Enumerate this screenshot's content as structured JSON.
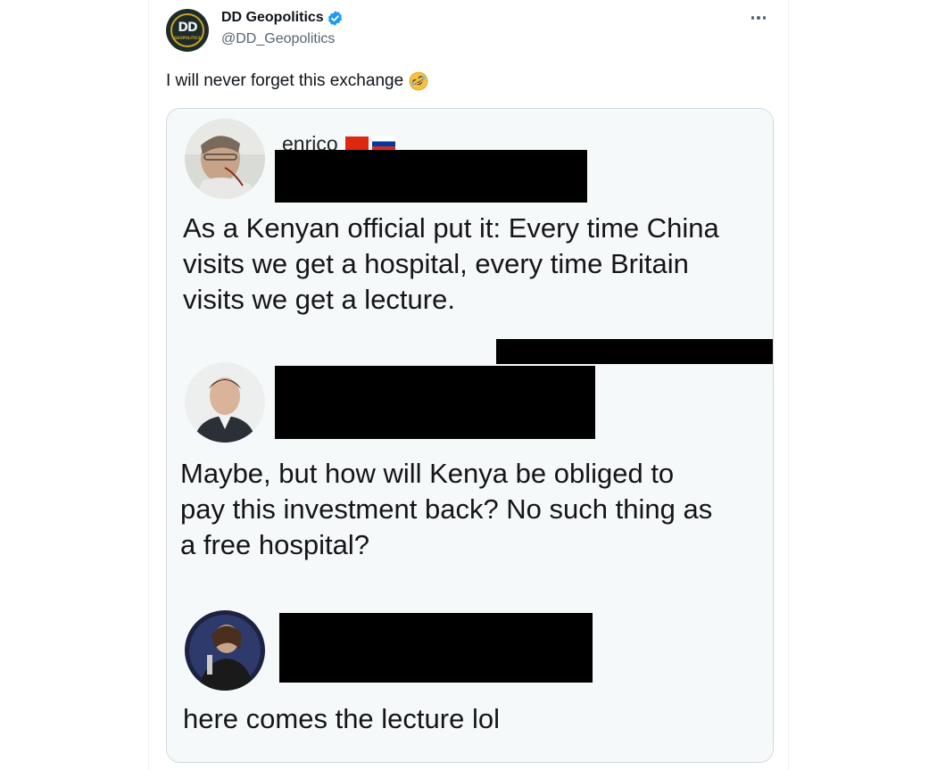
{
  "tweet": {
    "display_name": "DD Geopolitics",
    "handle": "@DD_Geopolitics",
    "verified": true,
    "avatar_text": "DD",
    "avatar_subtext": "GEOPOLITICS",
    "text": "I will never forget this exchange",
    "emoji": "rolling-on-floor-laughing-emoji",
    "more_icon": "more-options-icon",
    "accent_color": "#1d9bf0"
  },
  "media": {
    "comments": [
      {
        "username": "enrico",
        "flags": [
          "china-flag",
          "russia-flag"
        ],
        "text": "As a Kenyan official put it: Every time China\nvisits we get a hospital, every time Britain\nvisits we get a lecture."
      },
      {
        "username": "",
        "text": "Maybe, but how will Kenya be obliged to\npay this investment back? No such thing as\na free hospital?"
      },
      {
        "username": "",
        "text": "here comes the lecture lol"
      }
    ]
  }
}
